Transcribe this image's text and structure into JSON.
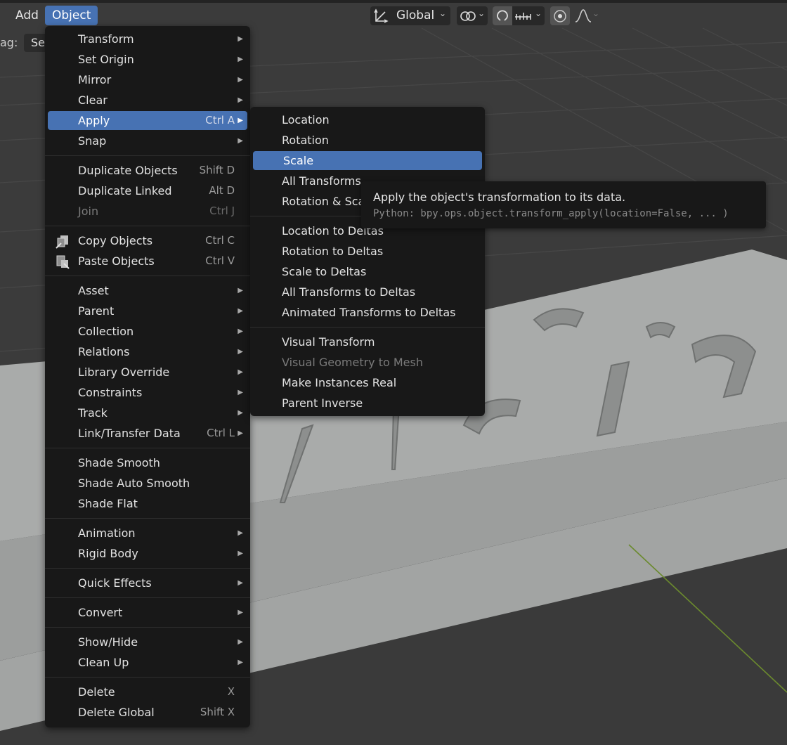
{
  "header": {
    "add_label": "Add",
    "object_label": "Object",
    "drag_label": "ag:",
    "select_label": "Se",
    "orientation_label": "Global"
  },
  "object_menu": {
    "groups": [
      [
        {
          "label": "Transform",
          "submenu": true
        },
        {
          "label": "Set Origin",
          "submenu": true
        },
        {
          "label": "Mirror",
          "submenu": true
        },
        {
          "label": "Clear",
          "submenu": true
        },
        {
          "label": "Apply",
          "shortcut": "Ctrl A",
          "submenu": true,
          "highlighted": true
        },
        {
          "label": "Snap",
          "submenu": true
        }
      ],
      [
        {
          "label": "Duplicate Objects",
          "shortcut": "Shift D"
        },
        {
          "label": "Duplicate Linked",
          "shortcut": "Alt D"
        },
        {
          "label": "Join",
          "shortcut": "Ctrl J",
          "disabled": true
        }
      ],
      [
        {
          "label": "Copy Objects",
          "shortcut": "Ctrl C",
          "icon": "copy-icon"
        },
        {
          "label": "Paste Objects",
          "shortcut": "Ctrl V",
          "icon": "paste-icon"
        }
      ],
      [
        {
          "label": "Asset",
          "submenu": true
        },
        {
          "label": "Parent",
          "submenu": true
        },
        {
          "label": "Collection",
          "submenu": true
        },
        {
          "label": "Relations",
          "submenu": true
        },
        {
          "label": "Library Override",
          "submenu": true
        },
        {
          "label": "Constraints",
          "submenu": true
        },
        {
          "label": "Track",
          "submenu": true
        },
        {
          "label": "Link/Transfer Data",
          "shortcut": "Ctrl L",
          "submenu": true
        }
      ],
      [
        {
          "label": "Shade Smooth"
        },
        {
          "label": "Shade Auto Smooth"
        },
        {
          "label": "Shade Flat"
        }
      ],
      [
        {
          "label": "Animation",
          "submenu": true
        },
        {
          "label": "Rigid Body",
          "submenu": true
        }
      ],
      [
        {
          "label": "Quick Effects",
          "submenu": true
        }
      ],
      [
        {
          "label": "Convert",
          "submenu": true
        }
      ],
      [
        {
          "label": "Show/Hide",
          "submenu": true
        },
        {
          "label": "Clean Up",
          "submenu": true
        }
      ],
      [
        {
          "label": "Delete",
          "shortcut": "X"
        },
        {
          "label": "Delete Global",
          "shortcut": "Shift X"
        }
      ]
    ]
  },
  "apply_menu": {
    "groups": [
      [
        {
          "label": "Location"
        },
        {
          "label": "Rotation"
        },
        {
          "label": "Scale",
          "highlighted": true
        },
        {
          "label": "All Transforms"
        },
        {
          "label": "Rotation & Scale"
        }
      ],
      [
        {
          "label": "Location to Deltas"
        },
        {
          "label": "Rotation to Deltas"
        },
        {
          "label": "Scale to Deltas"
        },
        {
          "label": "All Transforms to Deltas"
        },
        {
          "label": "Animated Transforms to Deltas"
        }
      ],
      [
        {
          "label": "Visual Transform"
        },
        {
          "label": "Visual Geometry to Mesh",
          "disabled": true
        },
        {
          "label": "Make Instances Real"
        },
        {
          "label": "Parent Inverse"
        }
      ]
    ]
  },
  "tooltip": {
    "description": "Apply the object's transformation to its data.",
    "python": "Python: bpy.ops.object.transform_apply(location=False, ... )"
  },
  "colors": {
    "menu_bg": "#181818",
    "highlight": "#4772b3",
    "viewport_bg": "#3a3a3a",
    "object_face": "#a9abaa"
  }
}
